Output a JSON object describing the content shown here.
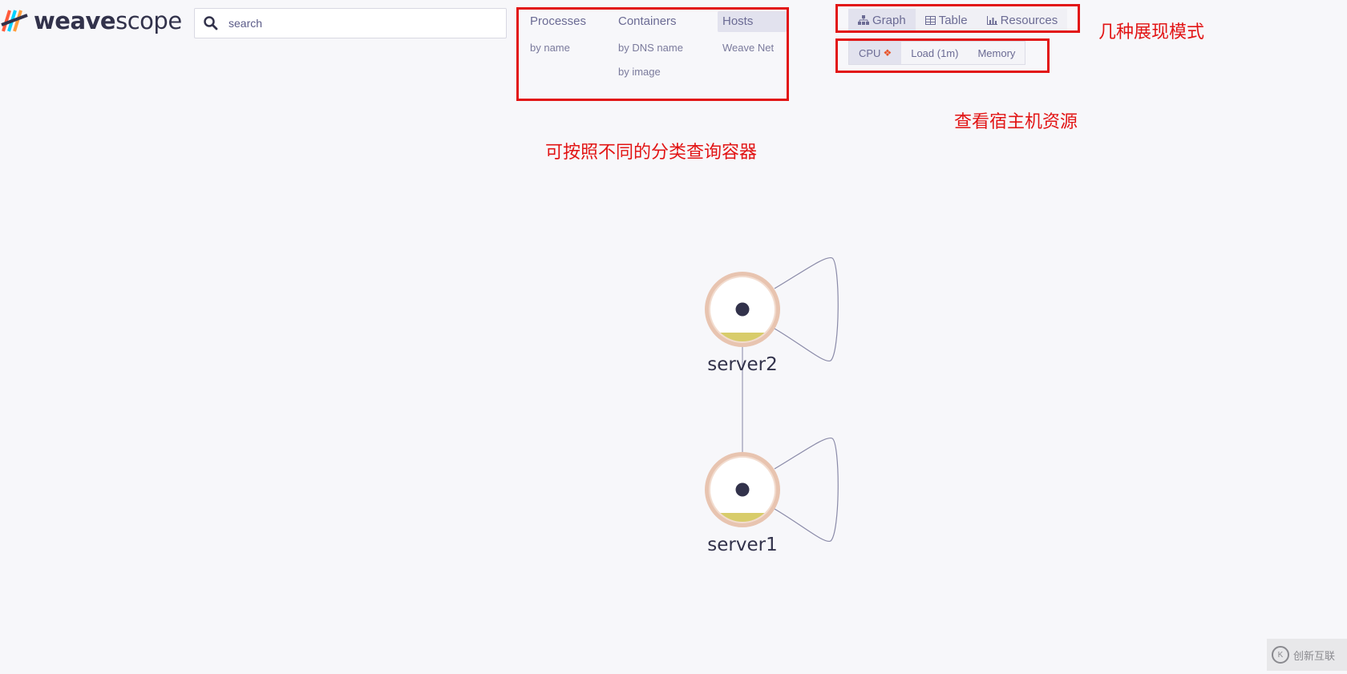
{
  "logo": {
    "text_bold": "weave",
    "text_light": "scope"
  },
  "search": {
    "placeholder": "search"
  },
  "topologies": [
    {
      "label": "Processes",
      "subs": [
        "by name"
      ]
    },
    {
      "label": "Containers",
      "subs": [
        "by DNS name",
        "by image"
      ]
    },
    {
      "label": "Hosts",
      "subs": [
        "Weave Net"
      ],
      "active": true
    }
  ],
  "view_modes": [
    {
      "label": "Graph",
      "icon": "graph-icon",
      "active": true
    },
    {
      "label": "Table",
      "icon": "table-icon"
    },
    {
      "label": "Resources",
      "icon": "chart-icon"
    }
  ],
  "metrics": [
    {
      "label": "CPU",
      "pinned": true,
      "active": true
    },
    {
      "label": "Load (1m)"
    },
    {
      "label": "Memory"
    }
  ],
  "annotations": {
    "modes": "几种展现模式",
    "resources": "查看宿主机资源",
    "topologies": "可按照不同的分类查询容器"
  },
  "nodes": [
    {
      "label": "server2"
    },
    {
      "label": "server1"
    }
  ],
  "watermark": {
    "text": "创新互联"
  },
  "colors": {
    "accent_red": "#e21414",
    "node_ring": "#e8c4b0",
    "node_fill": "#d8cc6a",
    "node_core": "#32324b"
  }
}
